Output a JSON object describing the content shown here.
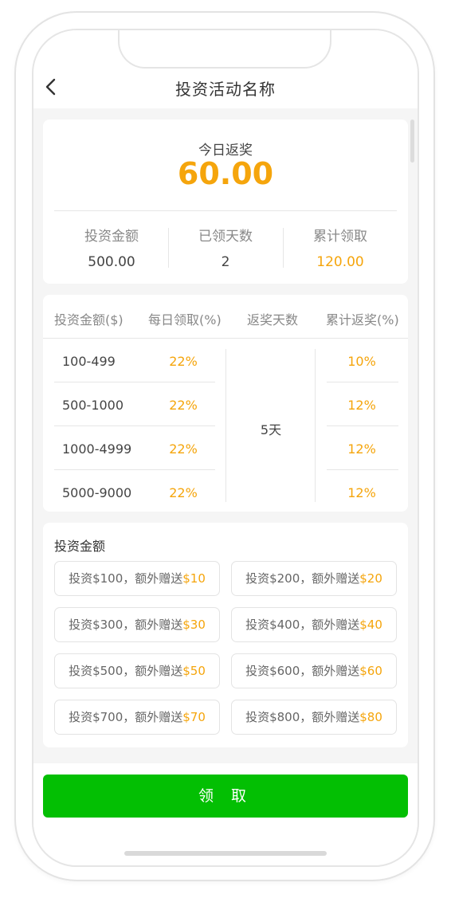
{
  "nav": {
    "title": "投资活动名称"
  },
  "summary": {
    "today_label": "今日返奖",
    "today_value": "60.00",
    "stats": [
      {
        "label": "投资金额",
        "value": "500.00"
      },
      {
        "label": "已领天数",
        "value": "2"
      },
      {
        "label": "累计领取",
        "value": "120.00"
      }
    ]
  },
  "table": {
    "headers": [
      "投资金额($)",
      "每日领取(%)",
      "返奖天数",
      "累计返奖(%)"
    ],
    "rows": [
      {
        "range": "100-499",
        "daily": "22%",
        "total": "10%"
      },
      {
        "range": "500-1000",
        "daily": "22%",
        "total": "12%"
      },
      {
        "range": "1000-4999",
        "daily": "22%",
        "total": "12%"
      },
      {
        "range": "5000-9000",
        "daily": "22%",
        "total": "12%"
      }
    ],
    "days": "5天"
  },
  "options": {
    "title": "投资金额",
    "items": [
      {
        "text": "投资$100，额外赠送",
        "gift": "$10"
      },
      {
        "text": "投资$200，额外赠送",
        "gift": "$20"
      },
      {
        "text": "投资$300，额外赠送",
        "gift": "$30"
      },
      {
        "text": "投资$400，额外赠送",
        "gift": "$40"
      },
      {
        "text": "投资$500，额外赠送",
        "gift": "$50"
      },
      {
        "text": "投资$600，额外赠送",
        "gift": "$60"
      },
      {
        "text": "投资$700，额外赠送",
        "gift": "$70"
      },
      {
        "text": "投资$800，额外赠送",
        "gift": "$80"
      }
    ]
  },
  "action": {
    "claim_label": "领 取"
  },
  "colors": {
    "accent": "#f5a50c",
    "primary_button": "#03bf03"
  },
  "icons": {
    "back": "chevron-left-icon"
  }
}
